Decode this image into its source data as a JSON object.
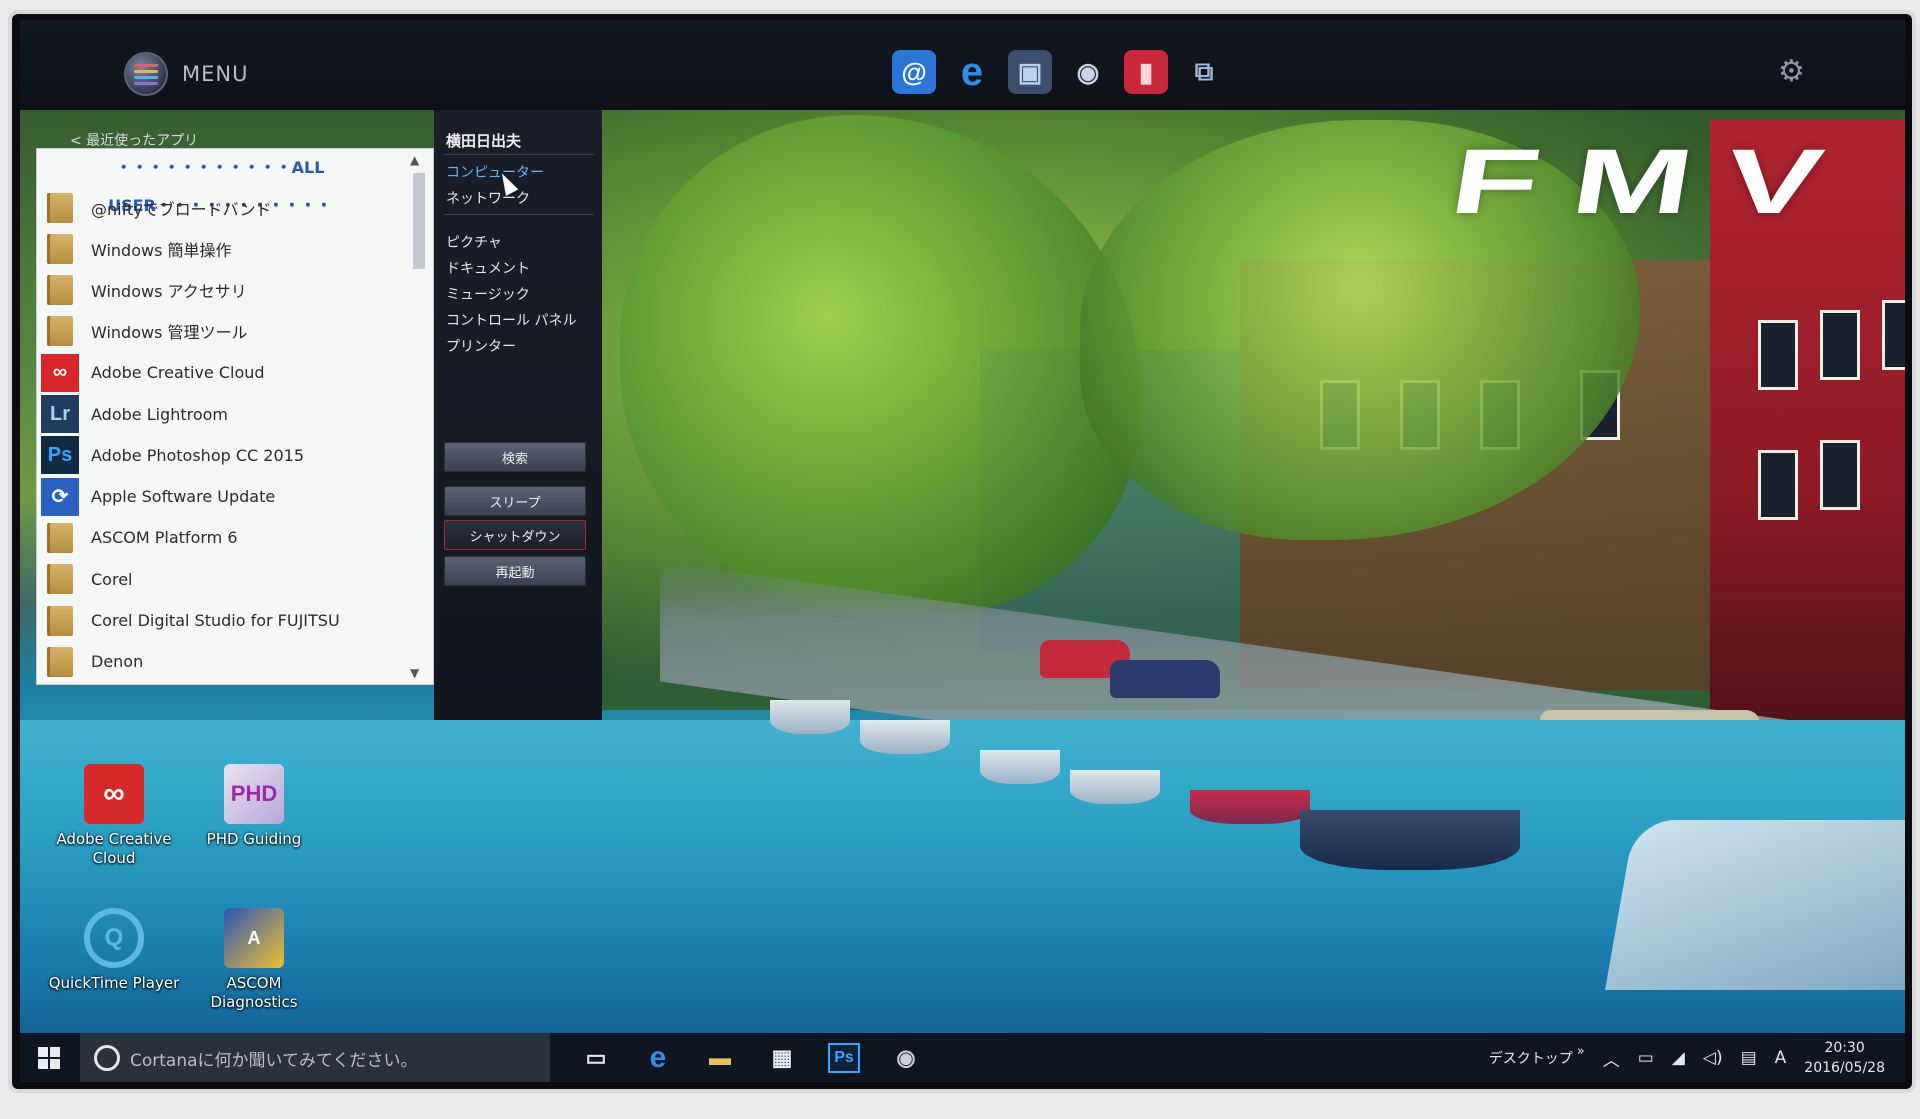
{
  "header": {
    "menu_label": "MENU",
    "settings_icon": "gear-icon",
    "quick_apps": [
      {
        "name": "mail-icon",
        "glyph": "@",
        "bg": "#2a76d6",
        "color": "#ffffff"
      },
      {
        "name": "internet-explorer-icon",
        "glyph": "e",
        "bg": "transparent",
        "color": "#2d8ee6"
      },
      {
        "name": "computer-icon",
        "glyph": "▣",
        "bg": "#3d4f6d",
        "color": "#b9d2f0"
      },
      {
        "name": "search-disc-icon",
        "glyph": "◉",
        "bg": "transparent",
        "color": "#c7d6e6"
      },
      {
        "name": "book-icon",
        "glyph": "▮",
        "bg": "#c9283a",
        "color": "#ffd3d8"
      },
      {
        "name": "network-icon",
        "glyph": "⧉",
        "bg": "transparent",
        "color": "#9fb8d8"
      }
    ]
  },
  "start_menu": {
    "recent_link": "< 最近使ったアプリ",
    "list_header": "・・・・・・・・・・・ALL USER・・・・・・・・・・・",
    "apps": [
      {
        "label": "@niftyでブロードバンド",
        "icon": "folder"
      },
      {
        "label": "Windows 簡単操作",
        "icon": "folder"
      },
      {
        "label": "Windows アクセサリ",
        "icon": "folder"
      },
      {
        "label": "Windows 管理ツール",
        "icon": "folder"
      },
      {
        "label": "Adobe Creative Cloud",
        "icon": "creative-cloud"
      },
      {
        "label": "Adobe Lightroom",
        "icon": "lightroom"
      },
      {
        "label": "Adobe Photoshop CC 2015",
        "icon": "photoshop"
      },
      {
        "label": "Apple Software Update",
        "icon": "apple-update"
      },
      {
        "label": "ASCOM Platform 6",
        "icon": "folder"
      },
      {
        "label": "Corel",
        "icon": "folder"
      },
      {
        "label": "Corel Digital Studio for FUJITSU",
        "icon": "folder"
      },
      {
        "label": "Denon",
        "icon": "folder"
      }
    ],
    "icon_text": {
      "lightroom": "Lr",
      "photoshop": "Ps"
    },
    "user_name": "横田日出夫",
    "places": [
      {
        "label": "コンピューター",
        "active": true
      },
      {
        "label": "ネットワーク",
        "active": false
      },
      {
        "label": "ピクチャ",
        "active": false
      },
      {
        "label": "ドキュメント",
        "active": false
      },
      {
        "label": "ミュージック",
        "active": false
      },
      {
        "label": "コントロール パネル",
        "active": false
      },
      {
        "label": "プリンター",
        "active": false
      }
    ],
    "buttons": {
      "search": "検索",
      "sleep": "スリープ",
      "shutdown": "シャットダウン",
      "restart": "再起動"
    }
  },
  "wallpaper": {
    "logo_text": "FMV"
  },
  "desktop_icons": [
    {
      "label": "Adobe Creative Cloud",
      "icon": "creative-cloud-icon"
    },
    {
      "label": "PHD Guiding",
      "icon": "phd-guiding-icon"
    },
    {
      "label": "QuickTime Player",
      "icon": "quicktime-icon"
    },
    {
      "label": "ASCOM Diagnostics",
      "icon": "ascom-diagnostics-icon"
    }
  ],
  "taskbar": {
    "search_placeholder": "Cortanaに何か聞いてみてください。",
    "desktop_label": "デスクトップ",
    "overflow": "»",
    "time": "20:30",
    "date": "2016/05/28",
    "ime": "A",
    "pinned": [
      {
        "name": "task-view-icon",
        "glyph": "▭",
        "color": "#e4e8ee"
      },
      {
        "name": "edge-icon",
        "glyph": "e",
        "color": "#2f8fe8"
      },
      {
        "name": "file-explorer-icon",
        "glyph": "▬",
        "color": "#e6c45a"
      },
      {
        "name": "store-icon",
        "glyph": "▦",
        "color": "#e4e8ee"
      },
      {
        "name": "photoshop-icon",
        "glyph": "Ps",
        "color": "#3ba4ff"
      },
      {
        "name": "menu-launcher-icon",
        "glyph": "◉",
        "color": "#c9ced8"
      }
    ],
    "tray_icons": [
      "chevron-up-icon",
      "battery-icon",
      "wifi-icon",
      "volume-icon",
      "notification-icon"
    ]
  },
  "colors": {
    "accent": "#2a56b6",
    "active_place": "#63b3ff",
    "taskbar": "#0f1622"
  }
}
